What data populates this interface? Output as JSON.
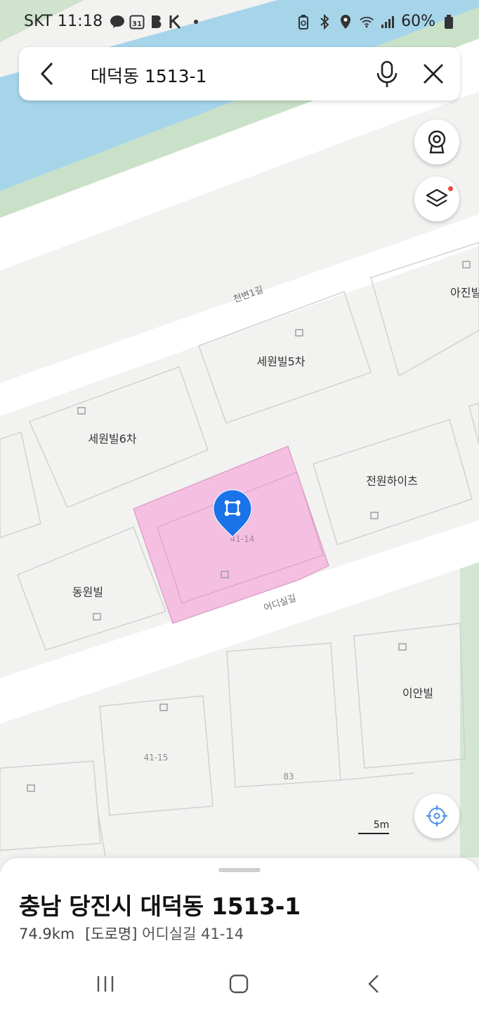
{
  "status_bar": {
    "carrier_time": "SKT 11:18",
    "left_icons": [
      "talk-icon",
      "calendar-31-icon",
      "b-icon",
      "k-icon",
      "dot-icon"
    ],
    "right_icons": [
      "battery-saver-icon",
      "bluetooth-icon",
      "location-icon",
      "wifi-icon",
      "signal-icon"
    ],
    "battery": "60%",
    "calendar_day": "31"
  },
  "search": {
    "query": "대덕동 1513-1"
  },
  "map": {
    "roads": [
      "천변1길",
      "어디실길"
    ],
    "buildings": [
      "세원빌5차",
      "세원빌6차",
      "전원하이츠",
      "동원빌",
      "이안빌",
      "아진빌"
    ],
    "lot_numbers": [
      "41-14",
      "41-15",
      "83"
    ],
    "scale": "5m",
    "selected_parcel_color": "#f4bfe0",
    "pin_color": "#1a73e8"
  },
  "bottom_sheet": {
    "title": "충남 당진시 대덕동 1513-1",
    "distance": "74.9km",
    "road_label": "[도로명]",
    "road_address": "어디실길 41-14"
  }
}
